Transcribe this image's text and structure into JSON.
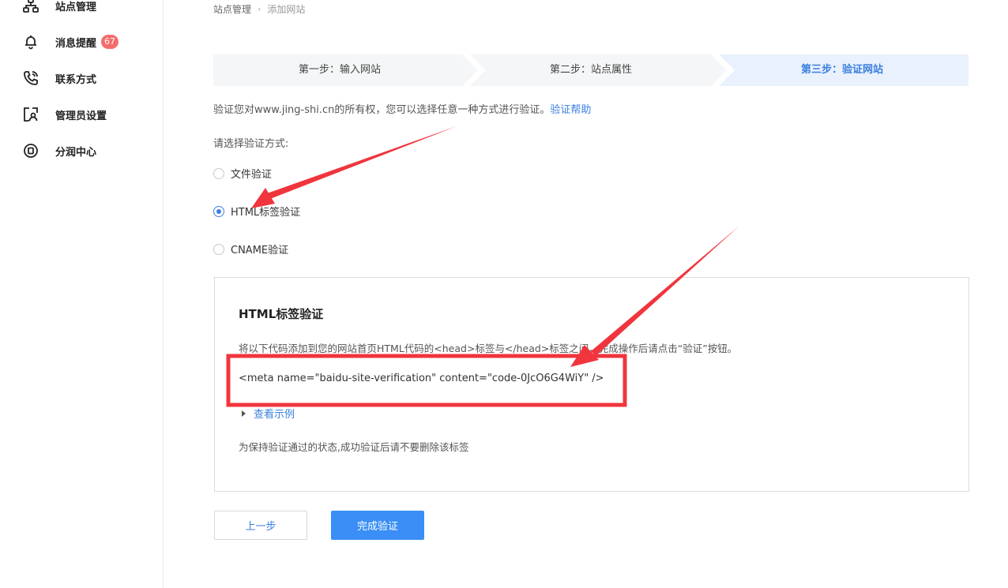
{
  "sidebar": {
    "items": [
      {
        "label": "站点管理",
        "icon": "sitemap-icon"
      },
      {
        "label": "消息提醒",
        "icon": "bell-icon",
        "badge": "67"
      },
      {
        "label": "联系方式",
        "icon": "phone-icon"
      },
      {
        "label": "管理员设置",
        "icon": "admin-profile-icon"
      },
      {
        "label": "分润中心",
        "icon": "profit-center-icon"
      }
    ]
  },
  "breadcrumb": {
    "root": "站点管理",
    "current": "添加网站"
  },
  "steps": [
    {
      "label": "第一步：输入网站",
      "active": false
    },
    {
      "label": "第二步：站点属性",
      "active": false
    },
    {
      "label": "第三步：验证网站",
      "active": true
    }
  ],
  "verification": {
    "description": "验证您对www.jing-shi.cn的所有权，您可以选择任意一种方式进行验证。",
    "help_link": "验证帮助",
    "choose_label": "请选择验证方式:",
    "methods": [
      {
        "label": "文件验证",
        "checked": false
      },
      {
        "label": "HTML标签验证",
        "checked": true
      },
      {
        "label": "CNAME验证",
        "checked": false
      }
    ]
  },
  "panel": {
    "title": "HTML标签验证",
    "description": "将以下代码添加到您的网站首页HTML代码的<head>标签与</head>标签之间，完成操作后请点击“验证”按钮。",
    "code": "<meta name=\"baidu-site-verification\" content=\"code-0JcO6G4WiY\" />",
    "example_link": "查看示例",
    "note": "为保持验证通过的状态,成功验证后请不要删除该标签"
  },
  "buttons": {
    "prev": "上一步",
    "finish": "完成验证"
  },
  "colors": {
    "accent": "#3a7fe0",
    "primary_button": "#3a8ef6",
    "badge": "#f56c6c",
    "annotation": "#f0353d"
  }
}
